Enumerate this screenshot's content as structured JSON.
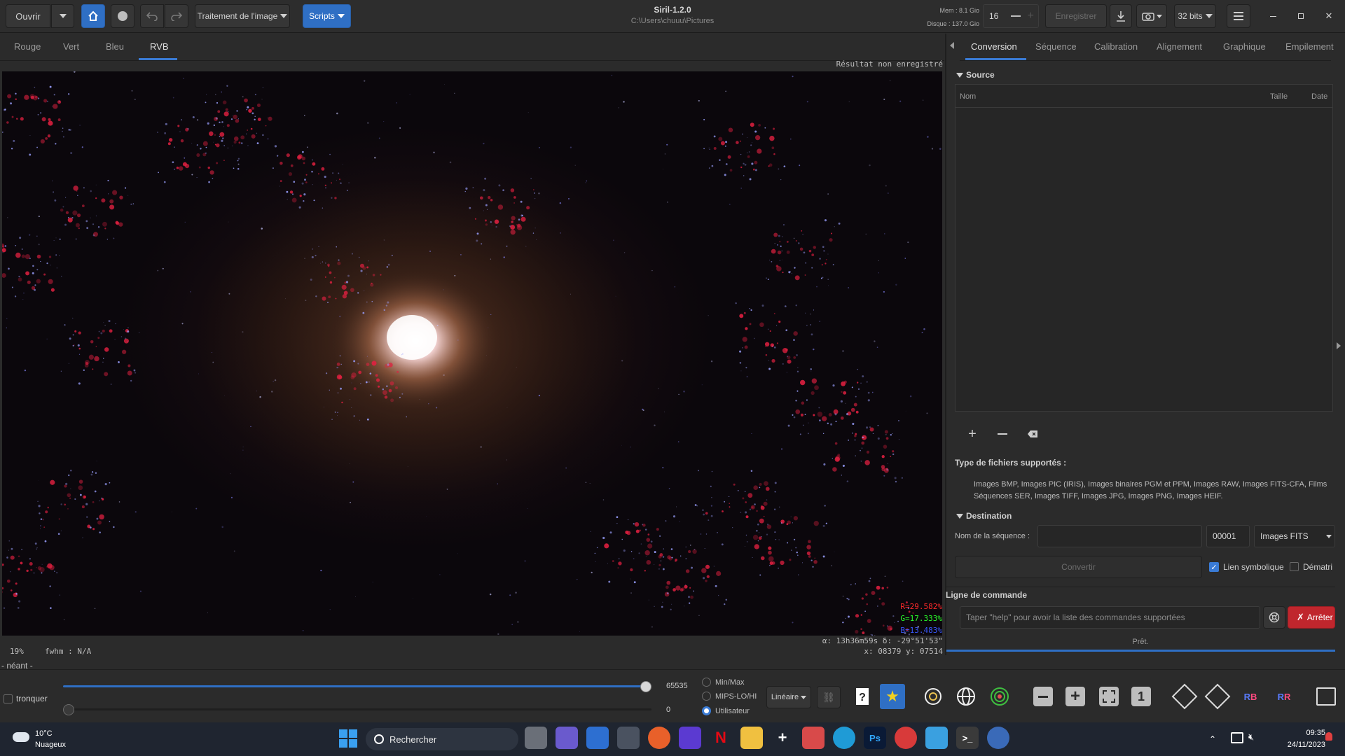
{
  "header": {
    "open_label": "Ouvrir",
    "image_processing_label": "Traitement de l'image",
    "scripts_label": "Scripts",
    "title": "Siril-1.2.0",
    "subtitle": "C:\\Users\\chuuu\\Pictures",
    "mem": "Mem : 8.1 Gio",
    "disk": "Disque : 137.0 Gio",
    "threads_value": "16",
    "save_label": "Enregistrer",
    "bit_depth": "32 bits"
  },
  "channel_tabs": [
    {
      "label": "Rouge"
    },
    {
      "label": "Vert"
    },
    {
      "label": "Bleu"
    },
    {
      "label": "RVB"
    }
  ],
  "viewer": {
    "unsaved": "Résultat non enregistré",
    "r_value": "R=29.582%",
    "g_value": "G=17.333%",
    "b_value": "B=13.483%",
    "zoom": "19%",
    "fwhm": "fwhm : N/A",
    "coords_radec": "α: 13h36m59s δ: -29°51'53\"",
    "coords_xy": "x: 08379 y: 07514",
    "image_name": "- néant -"
  },
  "right_tabs": [
    {
      "label": "Conversion"
    },
    {
      "label": "Séquence"
    },
    {
      "label": "Calibration"
    },
    {
      "label": "Alignement"
    },
    {
      "label": "Graphique"
    },
    {
      "label": "Empilement"
    }
  ],
  "conversion": {
    "source_label": "Source",
    "col_name": "Nom",
    "col_size": "Taille",
    "col_date": "Date",
    "supported_title": "Type de fichiers supportés :",
    "supported_line1": "Images BMP, Images PIC (IRIS), Images binaires PGM et PPM, Images RAW, Images FITS-CFA, Films",
    "supported_line2": "Séquences SER, Images TIFF, Images JPG, Images PNG, Images HEIF.",
    "destination_label": "Destination",
    "seq_name_label": "Nom de la séquence :",
    "seq_name_value": "",
    "start_index": "00001",
    "output_format": "Images FITS",
    "convert_label": "Convertir",
    "symlink_label": "Lien symbolique",
    "debayer_label": "Dématri"
  },
  "command": {
    "title": "Ligne de commande",
    "placeholder": "Taper \"help\" pour avoir la liste des commandes supportées",
    "stop_label": "Arrêter",
    "status": "Prêt."
  },
  "bottom": {
    "clip_label": "tronquer",
    "high_value": "65535",
    "low_value": "0",
    "high_fraction": 1.0,
    "low_fraction": 0.0,
    "mode_minmax": "Min/Max",
    "mode_mips": "MIPS-LO/HI",
    "mode_user": "Utilisateur",
    "stretch_label": "Linéaire"
  },
  "taskbar": {
    "weather_temp": "10°C",
    "weather_desc": "Nuageux",
    "search_label": "Rechercher",
    "time": "09:35",
    "date": "24/11/2023"
  }
}
